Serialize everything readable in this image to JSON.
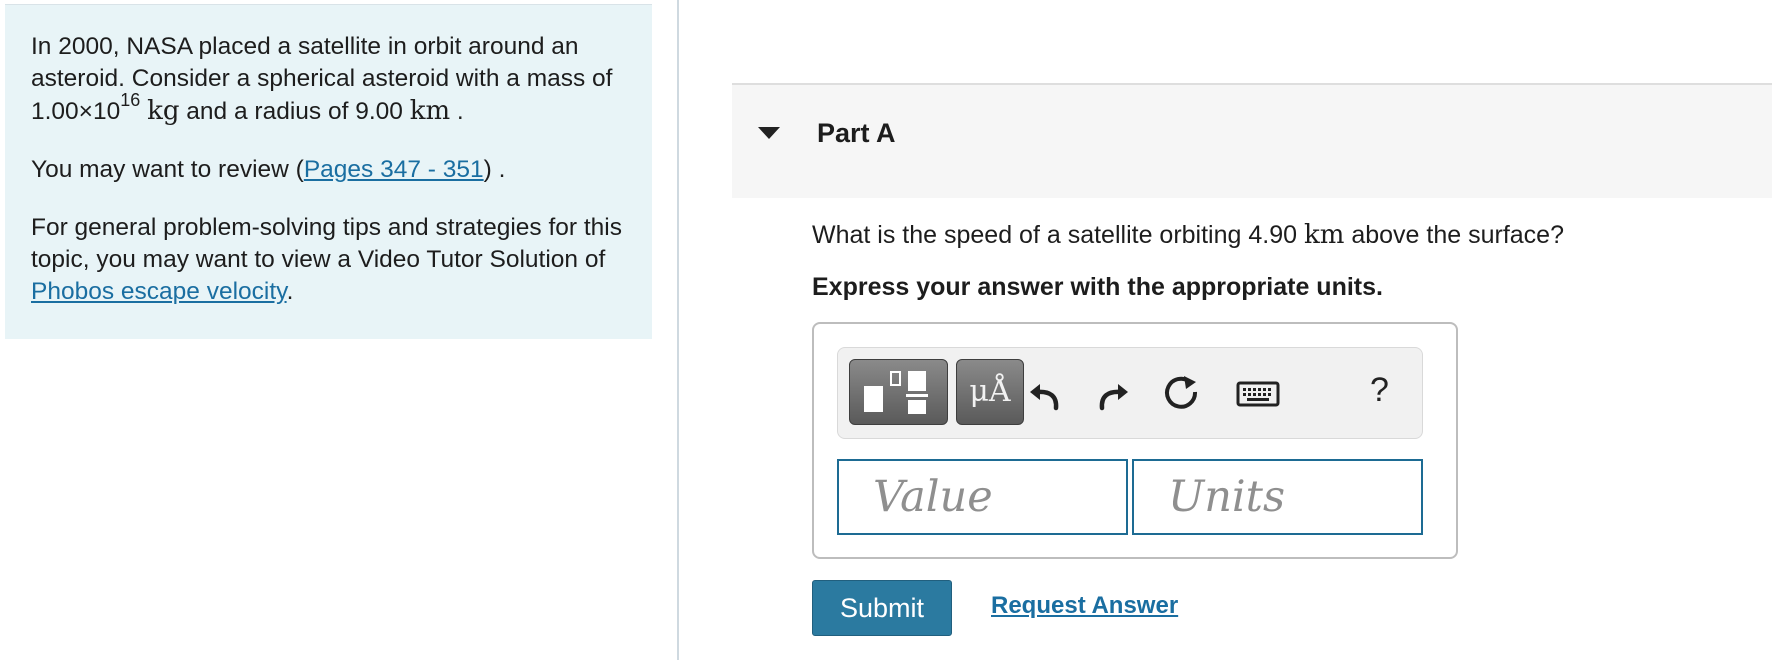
{
  "intro": {
    "p1_before": "In 2000, NASA placed a satellite in orbit around an asteroid. Consider a spherical asteroid with a mass of 1.00×10",
    "p1_exponent": "16",
    "p1_mass_unit": "kg",
    "p1_mid": " and a radius of 9.00 ",
    "p1_radius_unit": "km",
    "p1_end": " .",
    "p2_before": "You may want to review (",
    "p2_link": "Pages 347 - 351",
    "p2_after": ") .",
    "p3_before": "For general problem-solving tips and strategies for this topic, you may want to view a Video Tutor Solution of ",
    "p3_link": "Phobos escape velocity",
    "p3_after": "."
  },
  "part": {
    "title": "Part A",
    "question_before": "What is the speed of a satellite orbiting 4.90 ",
    "question_unit": "km",
    "question_after": " above the surface?",
    "instruction": "Express your answer with the appropriate units."
  },
  "toolbar": {
    "units_label": "μÅ",
    "help_label": "?",
    "icons": [
      "templates-icon",
      "units-icon",
      "undo-icon",
      "redo-icon",
      "reset-icon",
      "keyboard-icon",
      "help-icon"
    ]
  },
  "answer": {
    "value_placeholder": "Value",
    "units_placeholder": "Units",
    "value": "",
    "units": ""
  },
  "actions": {
    "submit_label": "Submit",
    "request_label": "Request Answer"
  },
  "colors": {
    "intro_bg": "#e8f4f7",
    "link": "#1a6ea1",
    "submit_bg": "#2b7aa0",
    "input_border": "#1d6b93"
  }
}
